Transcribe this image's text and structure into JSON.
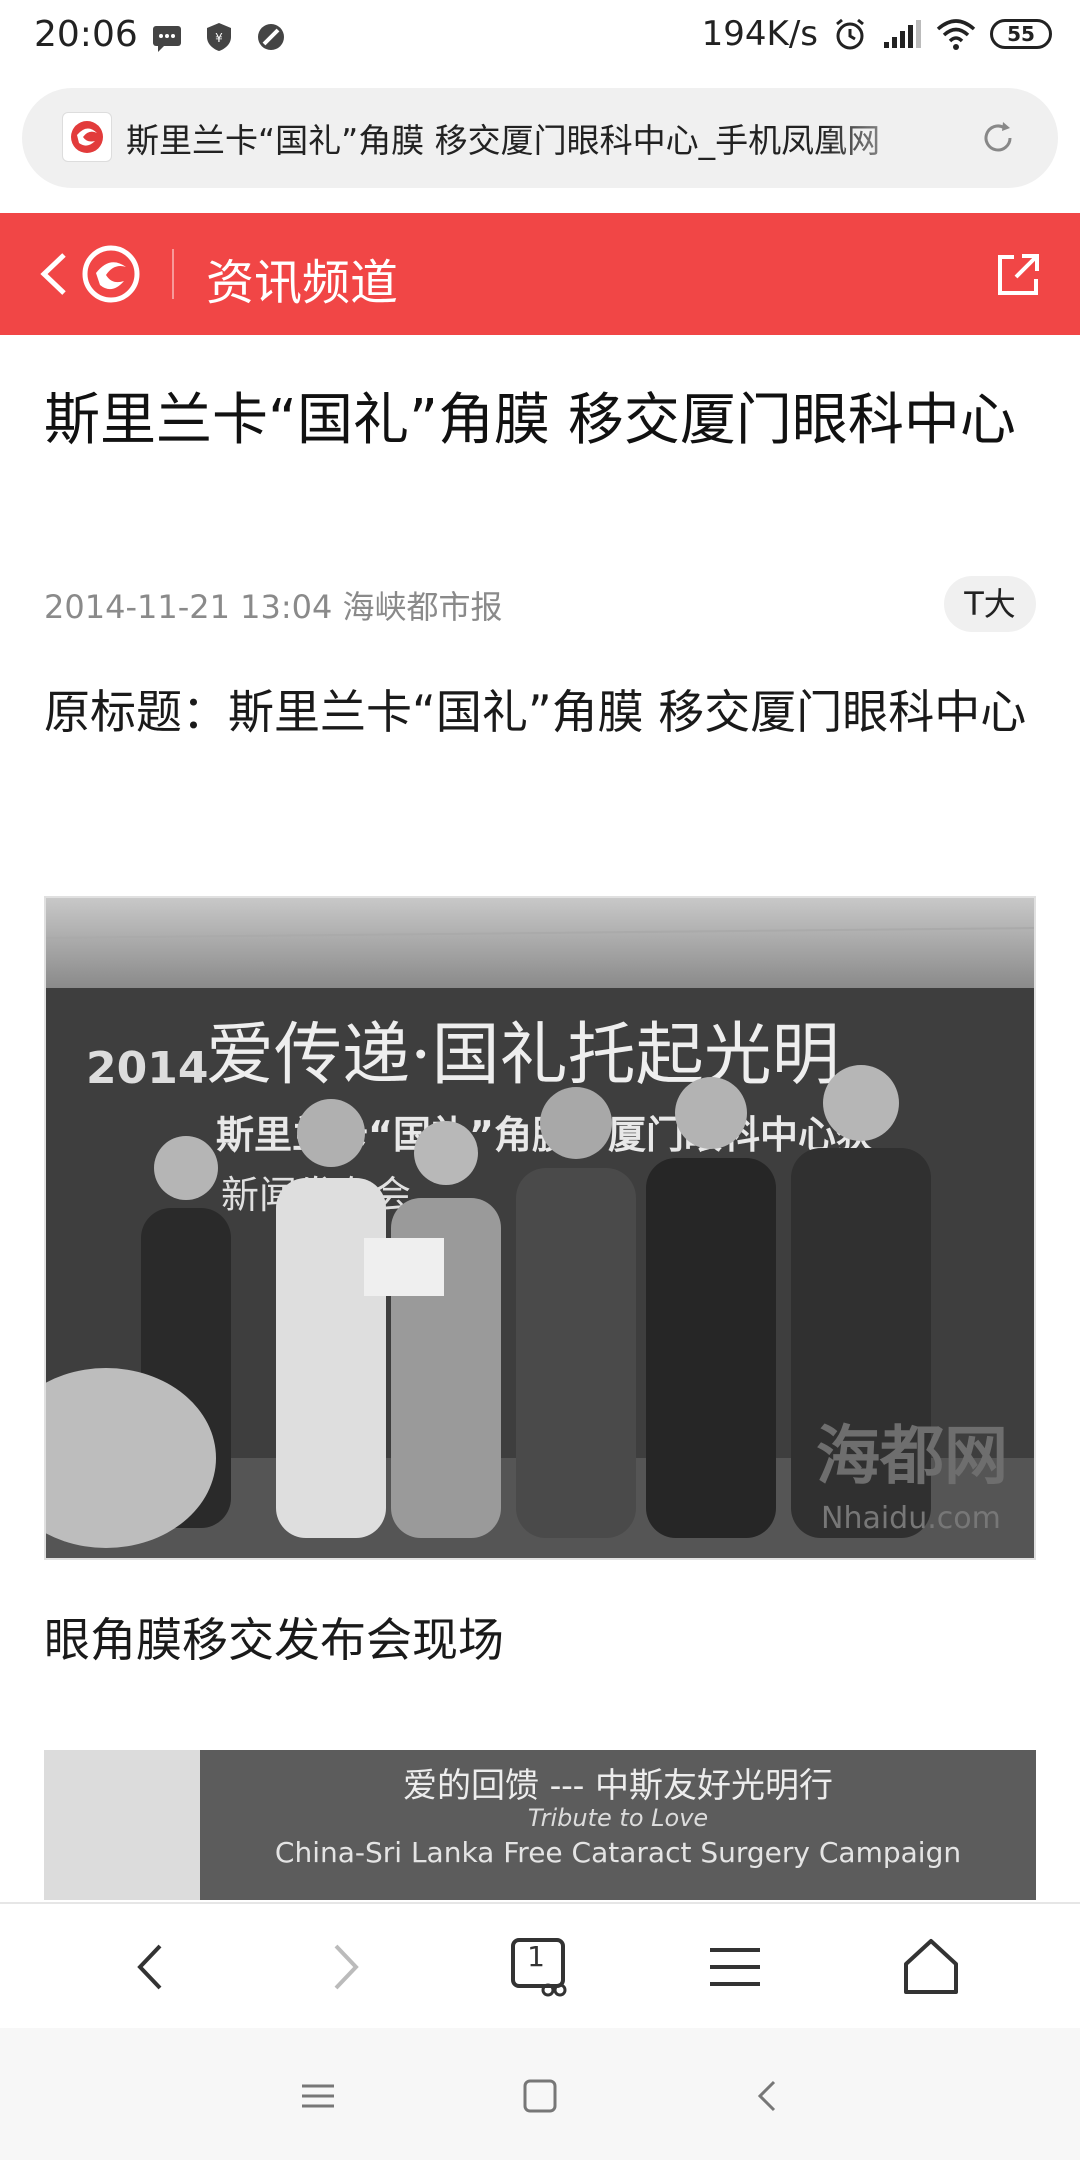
{
  "status_bar": {
    "time": "20:06",
    "net_speed": "194K/s",
    "battery": "55"
  },
  "url_bar": {
    "url_text": "斯里兰卡“国礼”角膜 移交厦门眼科中心_手机凤凰网"
  },
  "channel_header": {
    "title": "资讯频道",
    "accent_color": "#f14646"
  },
  "article": {
    "title": "斯里兰卡“国礼”角膜 移交厦门眼科中心",
    "meta": "2014-11-21 13:04 海峡都市报",
    "font_size_label": "T大",
    "original_title": "原标题：斯里兰卡“国礼”角膜 移交厦门眼科中心",
    "photo1": {
      "banner_line1": "爱传递·国礼托起光明",
      "banner_year": "2014",
      "banner_line2": "斯里兰卡“国礼”角膜，厦门眼科中心获",
      "banner_line3": "新闻发布会",
      "watermark": "海都网",
      "watermark_url": "Nhaidu.com"
    },
    "caption": "眼角膜移交发布会现场",
    "photo2": {
      "line1": "爱的回馈 --- 中斯友好光明行",
      "line2": "Tribute to Love",
      "line3": "China-Sri Lanka Free Cataract Surgery Campaign"
    }
  },
  "toolbar": {
    "tab_count": "1",
    "icons": [
      "back-icon",
      "forward-icon",
      "tabs-icon",
      "menu-icon",
      "home-icon"
    ]
  },
  "system_nav": {
    "icons": [
      "recent-apps-icon",
      "home-icon",
      "back-icon"
    ]
  }
}
